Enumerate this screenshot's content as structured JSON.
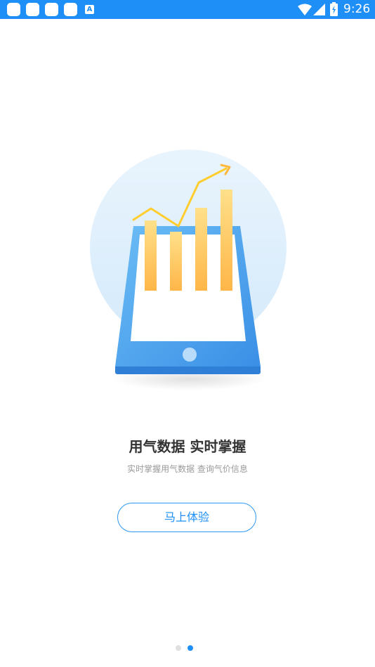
{
  "status_bar": {
    "time": "9:26",
    "color": "#1e8ff6",
    "a_icon_label": "A",
    "icons": [
      "notification-icon",
      "notification-icon",
      "notification-icon",
      "notification-icon",
      "a-app-icon",
      "wifi-icon",
      "signal-icon",
      "battery-charging-icon"
    ]
  },
  "onboarding": {
    "headline": "用气数据  实时掌握",
    "subtitle": "实时掌握用气数据 查询气价信息",
    "cta_label": "马上体验",
    "illustration": "tablet-bar-chart-growth-illustration"
  },
  "pager": {
    "page_count": 2,
    "active_index": 1,
    "active_color": "#1e8ff6",
    "inactive_color": "#e0e0e0"
  }
}
